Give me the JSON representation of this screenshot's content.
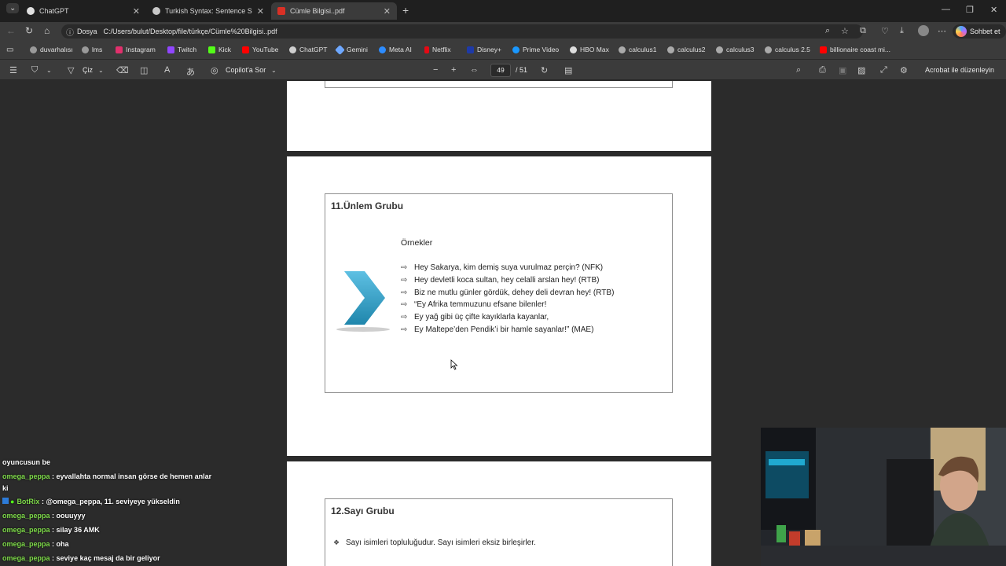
{
  "tabs": [
    {
      "label": "ChatGPT",
      "color": "#e0e0e0"
    },
    {
      "label": "Turkish Syntax: Sentence Structure",
      "color": "#c8c8c8"
    },
    {
      "label": "Cümle Bilgisi..pdf",
      "color": "#d93025"
    }
  ],
  "address": {
    "scheme_label": "Dosya",
    "url": "C:/Users/bulut/Desktop/file/türkçe/Cümle%20Bilgisi..pdf"
  },
  "copilot_button": "Sohbet et",
  "bookmarks": [
    {
      "label": "duvarhalısı",
      "color": "#9a9a9a"
    },
    {
      "label": "lms",
      "color": "#9a9a9a"
    },
    {
      "label": "Instagram",
      "color": "#e1306c"
    },
    {
      "label": "Twitch",
      "color": "#9146ff"
    },
    {
      "label": "Kick",
      "color": "#53fc18"
    },
    {
      "label": "YouTube",
      "color": "#ff0000"
    },
    {
      "label": "ChatGPT",
      "color": "#cfcfcf"
    },
    {
      "label": "Gemini",
      "color": "#6ea8ff"
    },
    {
      "label": "Meta AI",
      "color": "#2d8cff"
    },
    {
      "label": "Netflix",
      "color": "#e50914"
    },
    {
      "label": "Disney+",
      "color": "#1e3aa8"
    },
    {
      "label": "Prime Video",
      "color": "#1a98ff"
    },
    {
      "label": "HBO Max",
      "color": "#dddddd"
    },
    {
      "label": "calculus1",
      "color": "#aaaaaa"
    },
    {
      "label": "calculus2",
      "color": "#aaaaaa"
    },
    {
      "label": "calculus3",
      "color": "#aaaaaa"
    },
    {
      "label": "calculus 2.5",
      "color": "#aaaaaa"
    },
    {
      "label": "billionaire coast mi...",
      "color": "#ff0000"
    }
  ],
  "pdf_toolbar": {
    "draw_label": "Çiz",
    "copilot_label": "Copilot'a Sor",
    "current_page": "49",
    "total_pages": "/ 51",
    "acrobat_label": "Acrobat ile düzenleyin"
  },
  "slide11": {
    "title": "11.Ünlem Grubu",
    "examples_heading": "Örnekler",
    "examples": [
      "Hey Sakarya, kim demiş suya vurulmaz perçin? (NFK)",
      "Hey devletli koca sultan, hey celalli arslan hey! (RTB)",
      "Biz ne mutlu günler gördük, dehey deli devran hey! (RTB)",
      "“Ey Afrika temmuzunu efsane bilenler!",
      "Ey yağ gibi üç çifte kayıklarla kayanlar,",
      "Ey Maltepe’den Pendik’i bir hamle sayanlar!” (MAE)"
    ]
  },
  "slide12": {
    "title": "12.Sayı Grubu",
    "bullet": "Sayı isimleri topluluğudur. Sayı isimleri eksiz birleşirler."
  },
  "chat": [
    {
      "user": "",
      "text": "oyuncusun be"
    },
    {
      "user": "omega_peppa",
      "text": ": eyvallahta normal insan görse de hemen anlar ki"
    },
    {
      "user": "BotRix",
      "text": ": @omega_peppa, 11. seviyeye yükseldin"
    },
    {
      "user": "omega_peppa",
      "text": ": oouuyyy"
    },
    {
      "user": "omega_peppa",
      "text": ": silay 36 AMK"
    },
    {
      "user": "omega_peppa",
      "text": ": oha"
    },
    {
      "user": "omega_peppa",
      "text": ": seviye kaç mesaj da bir geliyor"
    }
  ]
}
